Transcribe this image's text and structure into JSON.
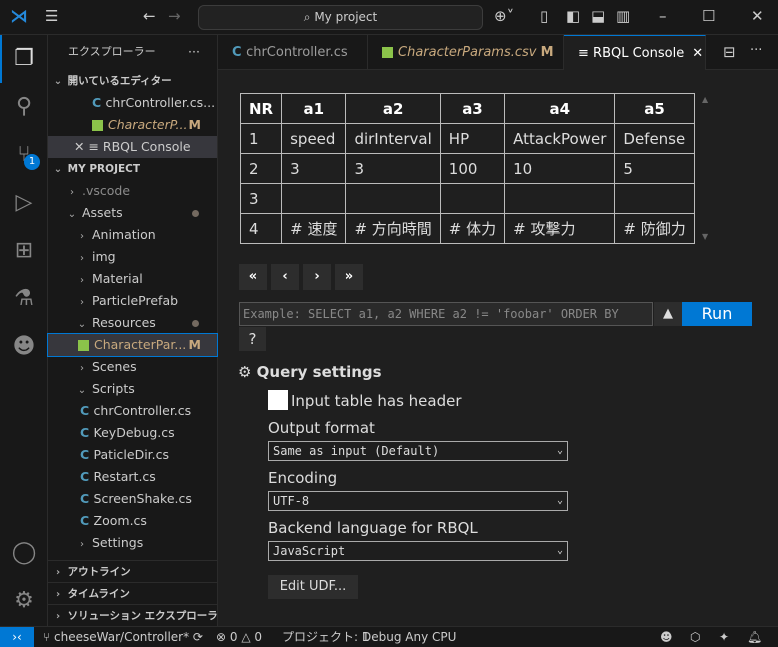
{
  "titlebar": {
    "search": "My project"
  },
  "tabs": [
    {
      "label": "chrController.cs"
    },
    {
      "label": "CharacterParams.csv",
      "badge": "M"
    },
    {
      "label": "RBQL Console"
    }
  ],
  "sidebar": {
    "title": "エクスプローラー",
    "open_editors": "開いているエディター",
    "open": [
      {
        "label": "chrController.cs..."
      },
      {
        "label": "CharacterP...",
        "badge": "M"
      },
      {
        "label": "RBQL Console"
      }
    ],
    "project": "MY PROJECT",
    "tree": [
      ".vscode",
      "Assets",
      "Animation",
      "img",
      "Material",
      "ParticlePrefab",
      "Resources",
      "CharacterPar...",
      "Scenes",
      "Scripts",
      "chrController.cs",
      "KeyDebug.cs",
      "PaticleDir.cs",
      "Restart.cs",
      "ScreenShake.cs",
      "Zoom.cs",
      "Settings"
    ],
    "badge_m": "M",
    "sections": [
      "アウトライン",
      "タイムライン",
      "ソリューション エクスプローラー"
    ]
  },
  "scm_badge": "1",
  "table": {
    "headers": [
      "NR",
      "a1",
      "a2",
      "a3",
      "a4",
      "a5"
    ],
    "rows": [
      [
        "1",
        "speed",
        "dirInterval",
        "HP",
        "AttackPower",
        "Defense"
      ],
      [
        "2",
        "3",
        "3",
        "100",
        "10",
        "5"
      ],
      [
        "3",
        "",
        "",
        "",
        "",
        ""
      ],
      [
        "4",
        "# 速度",
        "# 方向時間",
        "# 体力",
        "# 攻撃力",
        "# 防御力"
      ]
    ]
  },
  "pager": [
    "«",
    "‹",
    "›",
    "»"
  ],
  "query": {
    "placeholder": "Example: SELECT a1, a2 WHERE a2 != 'foobar' ORDER BY",
    "history": "▲",
    "run": "Run",
    "help": "?"
  },
  "settings": {
    "title": "Query settings",
    "header_checkbox": "Input table has header",
    "output_label": "Output format",
    "output_value": "Same as input (Default)",
    "encoding_label": "Encoding",
    "encoding_value": "UTF-8",
    "backend_label": "Backend language for RBQL",
    "backend_value": "JavaScript",
    "udf": "Edit UDF..."
  },
  "status": {
    "branch": "cheeseWar/Controller*",
    "errors": "0",
    "warnings": "0",
    "project": "プロジェクト: 1",
    "config": "Debug Any CPU"
  }
}
